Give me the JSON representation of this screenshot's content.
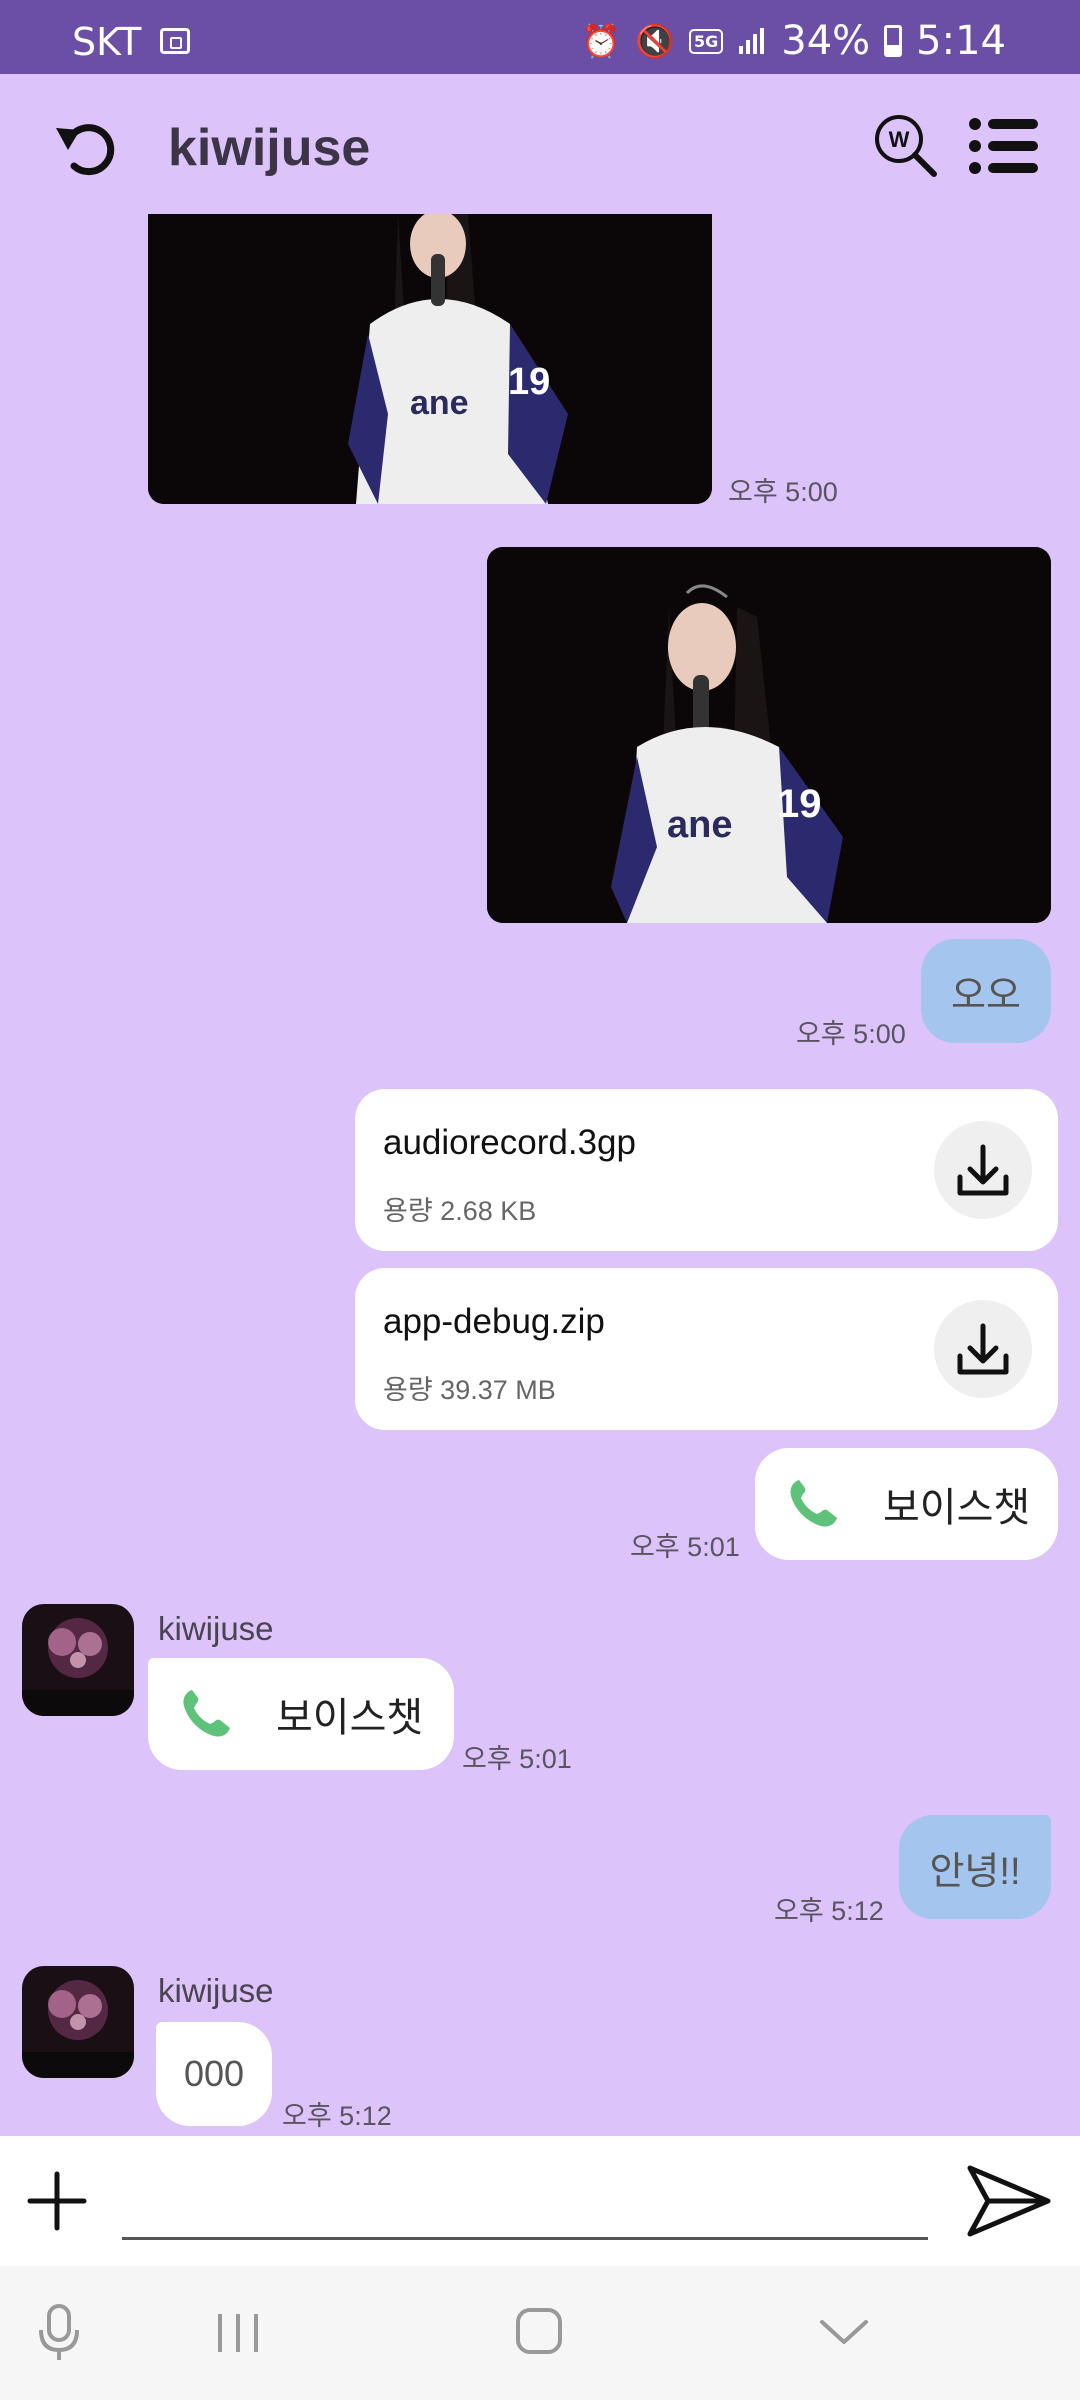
{
  "status_bar": {
    "carrier": "SKT",
    "network": "5G",
    "battery": "34%",
    "time": "5:14"
  },
  "header": {
    "title": "kiwijuse"
  },
  "messages": [
    {
      "type": "image",
      "side": "left",
      "time": "오후 5:00"
    },
    {
      "type": "image",
      "side": "right"
    },
    {
      "type": "text",
      "side": "right",
      "text": "오오",
      "time": "오후 5:00"
    },
    {
      "type": "file",
      "side": "right",
      "name": "audiorecord.3gp",
      "size": "용량 2.68 KB"
    },
    {
      "type": "file",
      "side": "right",
      "name": "app-debug.zip",
      "size": "용량 39.37 MB"
    },
    {
      "type": "voice",
      "side": "right",
      "text": "보이스챗",
      "time": "오후 5:01"
    },
    {
      "type": "voice",
      "side": "left",
      "sender": "kiwijuse",
      "text": "보이스챗",
      "time": "오후 5:01"
    },
    {
      "type": "text",
      "side": "right",
      "text": "안녕!!",
      "time": "오후 5:12"
    },
    {
      "type": "text",
      "side": "left",
      "sender": "kiwijuse",
      "text": "000",
      "time": "오후 5:12"
    }
  ],
  "input": {
    "placeholder": ""
  },
  "icons": {
    "back": "refresh-back-icon",
    "search": "search-w-icon",
    "menu": "list-menu-icon",
    "download": "download-icon",
    "phone": "phone-icon",
    "plus": "plus-icon",
    "send": "send-icon",
    "mic": "mic-icon",
    "recent": "recent-apps-icon",
    "home": "home-icon",
    "hide": "hide-keyboard-icon"
  },
  "colors": {
    "status_bar": "#6b4fa6",
    "chat_background": "#dcc4fa",
    "my_bubble": "#a4c5ee",
    "other_bubble": "#ffffff",
    "phone_green": "#5ec27a"
  }
}
